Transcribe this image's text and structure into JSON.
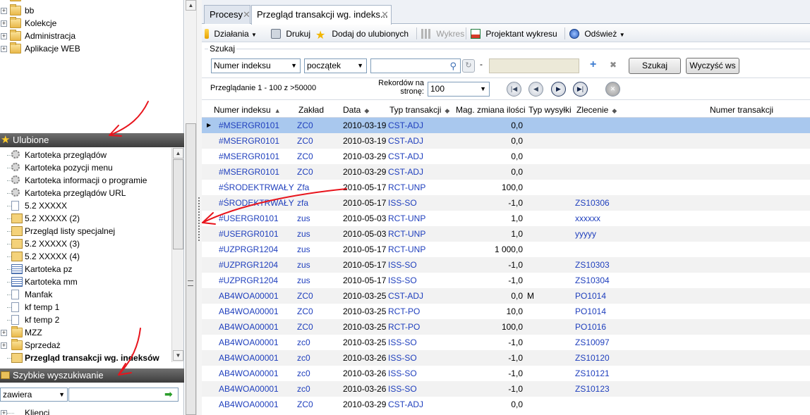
{
  "left": {
    "tree_top": [
      {
        "label": "bb"
      },
      {
        "label": "Kolekcje"
      },
      {
        "label": "Administracja"
      },
      {
        "label": "Aplikacje WEB"
      }
    ],
    "favorites": {
      "title": "Ulubione",
      "items": [
        {
          "label": "Kartoteka przeglądów",
          "icon": "gear-icon"
        },
        {
          "label": "Kartoteka pozycji menu",
          "icon": "gear-icon"
        },
        {
          "label": "Kartoteka informacji o programie",
          "icon": "gear-icon"
        },
        {
          "label": "Kartoteka przeglądów URL",
          "icon": "gear-icon"
        },
        {
          "label": "5.2 XXXXX",
          "icon": "document-icon"
        },
        {
          "label": "5.2 XXXXX (2)",
          "icon": "favorite-view-icon"
        },
        {
          "label": "Przegląd listy specjalnej",
          "icon": "favorite-view-icon"
        },
        {
          "label": "5.2 XXXXX (3)",
          "icon": "favorite-view-icon"
        },
        {
          "label": "5.2 XXXXX (4)",
          "icon": "favorite-view-icon"
        },
        {
          "label": "Kartoteka pz",
          "icon": "grid-icon"
        },
        {
          "label": "Kartoteka mm",
          "icon": "grid-icon"
        },
        {
          "label": "Manfak",
          "icon": "document-icon"
        },
        {
          "label": "kf temp 1",
          "icon": "document-icon"
        },
        {
          "label": "kf temp 2",
          "icon": "document-icon"
        },
        {
          "label": "MZZ",
          "icon": "folder-icon"
        },
        {
          "label": "Sprzedaż",
          "icon": "folder-icon"
        },
        {
          "label": "Przegląd transakcji wg. indeksów",
          "icon": "favorite-view-icon"
        }
      ]
    },
    "quick_search": {
      "title": "Szybkie wyszukiwanie",
      "mode": "zawiera",
      "value": "",
      "tree_item": "Klienci"
    }
  },
  "tabs": [
    {
      "label": "Procesy"
    },
    {
      "label": "Przegląd transakcji wg. indeks..."
    }
  ],
  "toolbar": {
    "actions": "Działania",
    "print": "Drukuj",
    "add_fav": "Dodaj do ulubionych",
    "chart": "Wykres",
    "chart_designer": "Projektant wykresu",
    "refresh": "Odśwież"
  },
  "search": {
    "legend": "Szukaj",
    "field": "Numer indeksu",
    "match": "początek",
    "value": "",
    "dash": "-",
    "search_btn": "Szukaj",
    "clear_btn": "Wyczyść ws"
  },
  "pager": {
    "info": "Przeglądanie 1 - 100 z >50000",
    "records_label_1": "Rekordów na",
    "records_label_2": "stronę:",
    "per_page": "100"
  },
  "grid": {
    "columns": [
      "Numer indeksu",
      "Zakład",
      "Data",
      "Typ transakcji",
      "Mag. zmiana ilości",
      "Typ wysyłki",
      "Zlecenie",
      "Numer transakcji"
    ],
    "rows": [
      [
        "#MSERGR0101",
        "ZC0",
        "2010-03-19",
        "CST-ADJ",
        "0,0",
        "",
        ""
      ],
      [
        "#MSERGR0101",
        "ZC0",
        "2010-03-19",
        "CST-ADJ",
        "0,0",
        "",
        ""
      ],
      [
        "#MSERGR0101",
        "ZC0",
        "2010-03-29",
        "CST-ADJ",
        "0,0",
        "",
        ""
      ],
      [
        "#MSERGR0101",
        "ZC0",
        "2010-03-29",
        "CST-ADJ",
        "0,0",
        "",
        ""
      ],
      [
        "#ŚRODEKTRWAŁY",
        "Zfa",
        "2010-05-17",
        "RCT-UNP",
        "100,0",
        "",
        ""
      ],
      [
        "#ŚRODEKTRWAŁY",
        "zfa",
        "2010-05-17",
        "ISS-SO",
        "-1,0",
        "",
        "ZS10306"
      ],
      [
        "#USERGR0101",
        "zus",
        "2010-05-03",
        "RCT-UNP",
        "1,0",
        "",
        "xxxxxx"
      ],
      [
        "#USERGR0101",
        "zus",
        "2010-05-03",
        "RCT-UNP",
        "1,0",
        "",
        "yyyyy"
      ],
      [
        "#UZPRGR1204",
        "zus",
        "2010-05-17",
        "RCT-UNP",
        "1 000,0",
        "",
        ""
      ],
      [
        "#UZPRGR1204",
        "zus",
        "2010-05-17",
        "ISS-SO",
        "-1,0",
        "",
        "ZS10303"
      ],
      [
        "#UZPRGR1204",
        "zus",
        "2010-05-17",
        "ISS-SO",
        "-1,0",
        "",
        "ZS10304"
      ],
      [
        "AB4WOA00001",
        "ZC0",
        "2010-03-25",
        "CST-ADJ",
        "0,0",
        "M",
        "PO1014"
      ],
      [
        "AB4WOA00001",
        "ZC0",
        "2010-03-25",
        "RCT-PO",
        "10,0",
        "",
        "PO1014"
      ],
      [
        "AB4WOA00001",
        "ZC0",
        "2010-03-25",
        "RCT-PO",
        "100,0",
        "",
        "PO1016"
      ],
      [
        "AB4WOA00001",
        "zc0",
        "2010-03-25",
        "ISS-SO",
        "-1,0",
        "",
        "ZS10097"
      ],
      [
        "AB4WOA00001",
        "zc0",
        "2010-03-26",
        "ISS-SO",
        "-1,0",
        "",
        "ZS10120"
      ],
      [
        "AB4WOA00001",
        "zc0",
        "2010-03-26",
        "ISS-SO",
        "-1,0",
        "",
        "ZS10121"
      ],
      [
        "AB4WOA00001",
        "zc0",
        "2010-03-26",
        "ISS-SO",
        "-1,0",
        "",
        "ZS10123"
      ],
      [
        "AB4WOA00001",
        "ZC0",
        "2010-03-29",
        "CST-ADJ",
        "0,0",
        "",
        ""
      ]
    ]
  },
  "colors": {
    "link": "#1f3fbd",
    "selected_row": "#a9c8ee",
    "annotation": "#e8141c"
  }
}
